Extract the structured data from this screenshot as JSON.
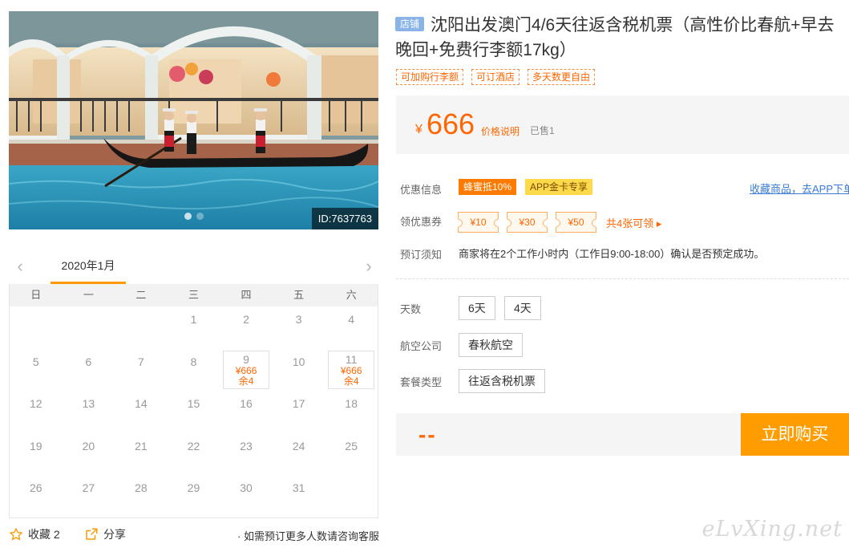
{
  "photo": {
    "image_id": "ID:7637763",
    "slides": 2
  },
  "calendar": {
    "prev_icon": "chevron-left-icon",
    "next_icon": "chevron-right-icon",
    "month": "2020年1月",
    "weekdays": [
      "日",
      "一",
      "二",
      "三",
      "四",
      "五",
      "六"
    ],
    "leading_blanks": 3,
    "days": [
      {
        "day": "1"
      },
      {
        "day": "2"
      },
      {
        "day": "3"
      },
      {
        "day": "4"
      },
      {
        "day": "5"
      },
      {
        "day": "6"
      },
      {
        "day": "7"
      },
      {
        "day": "8"
      },
      {
        "day": "9",
        "price": "¥666",
        "stock": "余4"
      },
      {
        "day": "10"
      },
      {
        "day": "11",
        "price": "¥666",
        "stock": "余4"
      },
      {
        "day": "12"
      },
      {
        "day": "13"
      },
      {
        "day": "14"
      },
      {
        "day": "15"
      },
      {
        "day": "16"
      },
      {
        "day": "17"
      },
      {
        "day": "18"
      },
      {
        "day": "19"
      },
      {
        "day": "20"
      },
      {
        "day": "21"
      },
      {
        "day": "22"
      },
      {
        "day": "23"
      },
      {
        "day": "24"
      },
      {
        "day": "25"
      },
      {
        "day": "26"
      },
      {
        "day": "27"
      },
      {
        "day": "28"
      },
      {
        "day": "29"
      },
      {
        "day": "30"
      },
      {
        "day": "31"
      }
    ]
  },
  "bottom_bar": {
    "favorite_label": "收藏 2",
    "share_label": "分享",
    "consult_text": "· 如需预订更多人数请咨询客服"
  },
  "product": {
    "shop_badge": "店铺",
    "title": "沈阳出发澳门4/6天往返含税机票（高性价比春航+早去晚回+免费行李额17kg）",
    "tags": [
      "可加购行李额",
      "可订酒店",
      "多天数更自由"
    ]
  },
  "price": {
    "currency": "¥",
    "value": "666",
    "note": "价格说明",
    "sold": "已售1"
  },
  "promotions": {
    "label": "优惠信息",
    "items": [
      "蜂蜜抵10%",
      "APP金卡专享"
    ],
    "collect_link": "收藏商品，去APP下单"
  },
  "coupons": {
    "label": "领优惠券",
    "items": [
      "¥10",
      "¥30",
      "¥50"
    ],
    "more": "共4张可领 ▸"
  },
  "booking_notice": {
    "label": "预订须知",
    "text": "商家将在2个工作小时内（工作日9:00-18:00）确认是否预定成功。"
  },
  "options": {
    "days_label": "天数",
    "days": [
      "6天",
      "4天"
    ],
    "airline_label": "航空公司",
    "airline": "春秋航空",
    "package_label": "套餐类型",
    "package": "往返含税机票"
  },
  "buy": {
    "total": "--",
    "button": "立即购买"
  },
  "watermark": "eLvXing.net",
  "colors": {
    "accent": "#ff6600",
    "buy_button": "#ff9c00",
    "link": "#3a7bd5",
    "badge": "#8ab4e8"
  }
}
